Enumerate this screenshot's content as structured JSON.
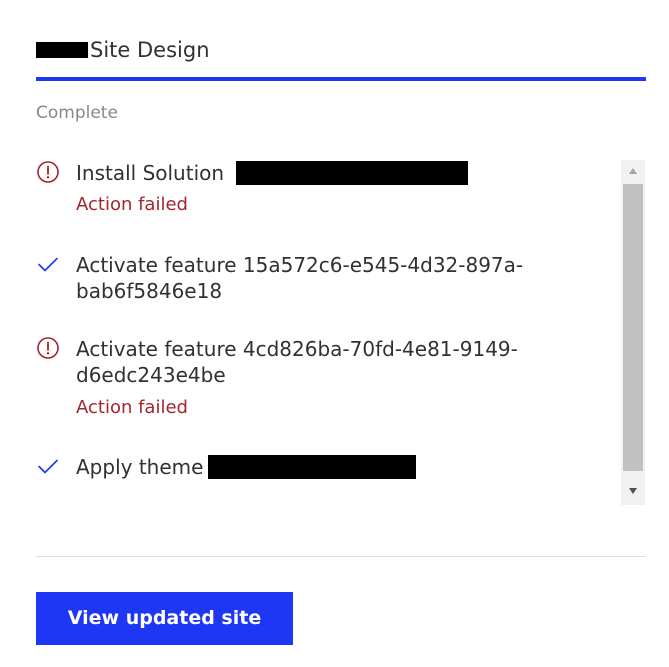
{
  "header": {
    "title": "Site Design",
    "accent_color": "#1d37f5"
  },
  "status": {
    "label": "Complete"
  },
  "steps": [
    {
      "status": "failed",
      "icon": "error-circle-icon",
      "text": "Install Solution",
      "error": "Action failed"
    },
    {
      "status": "success",
      "icon": "checkmark-icon",
      "text": "Activate feature 15a572c6-e545-4d32-897a-bab6f5846e18"
    },
    {
      "status": "failed",
      "icon": "error-circle-icon",
      "text": "Activate feature 4cd826ba-70fd-4e81-9149-d6edc243e4be",
      "error": "Action failed"
    },
    {
      "status": "success",
      "icon": "checkmark-icon",
      "text": "Apply theme"
    }
  ],
  "footer": {
    "button_label": "View updated site"
  },
  "colors": {
    "error": "#a4262c",
    "success": "#1d37f5",
    "muted": "#8a8886"
  }
}
